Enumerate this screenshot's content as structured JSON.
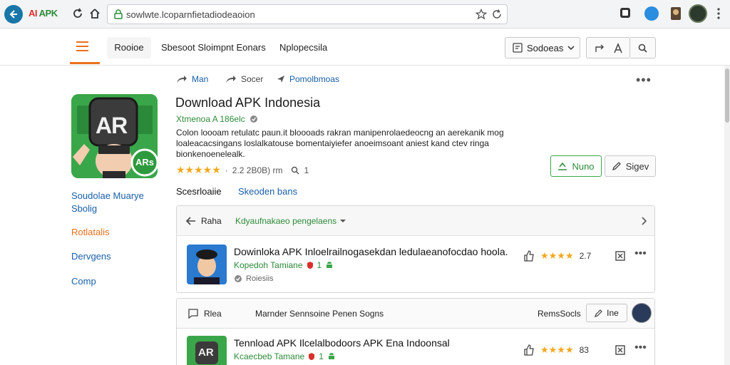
{
  "browser": {
    "brand_part1": "AI",
    "brand_part2": "APK",
    "url": "sowlwte.lcoparnfietadiodeaoion"
  },
  "nav": {
    "tab1": "Rooioe",
    "tab2": "Sbesoot Sloimpnt  Eonars",
    "tab3": "Nplopecsila",
    "sort_label": "Sodoeas"
  },
  "breadcrumb": {
    "item1": "Man",
    "item2": "Socer",
    "item3": "Pomolbmoas"
  },
  "app": {
    "icon_text": "AR",
    "icon_badge": "ARs",
    "title": "Download APK Indonesia",
    "subtitle": "Xtmenoa A 186elc",
    "description": "Colon loooam retulatc paun.it bloooads rakran manipenrolaedeocng an aerekanik mog loaleacacsingans loslalkatouse bomentaiyiefer anoeimsoant aniest kand ctev ringa bionkenoenelealk.",
    "rating_stars": "★★★★★",
    "rating_text": "2.2 2B0B) rm",
    "rating_count": "1",
    "primary_button": "Nuno",
    "secondary_button": "Sigev"
  },
  "sidebar": {
    "item1_line1": "Soudolae Muarye",
    "item1_line2": "Sbolig",
    "item2": "Rotlatalis",
    "item3": "Dervgens",
    "item4": "Comp"
  },
  "tabs": {
    "tab1": "Scesrloaiie",
    "tab2": "Skeoden bans"
  },
  "card1": {
    "back_label": "Raha",
    "filter_label": "Kdyaufnakaeo pengelaens",
    "item": {
      "title": "Dowinloka APK Inloelrailnogasekdan ledulaeanofocdao hoola.",
      "sub": "Kopedoh Tamiane",
      "sub_count": "1",
      "meta": "Roiesiis",
      "stars": "★★★★",
      "score": "2.7"
    }
  },
  "card2": {
    "head_left": "Rlea",
    "head_mid": "Marnder Sennsoine  Penen Sogns",
    "head_right": "RemsSocls",
    "btn": "Ine",
    "item": {
      "title": "Tennload APK Ilcelalbodoors APK Ena Indoonsal",
      "sub": "Kcaecbeb Tamane",
      "sub_count": "1",
      "stars": "★★★★",
      "score": "83"
    }
  }
}
